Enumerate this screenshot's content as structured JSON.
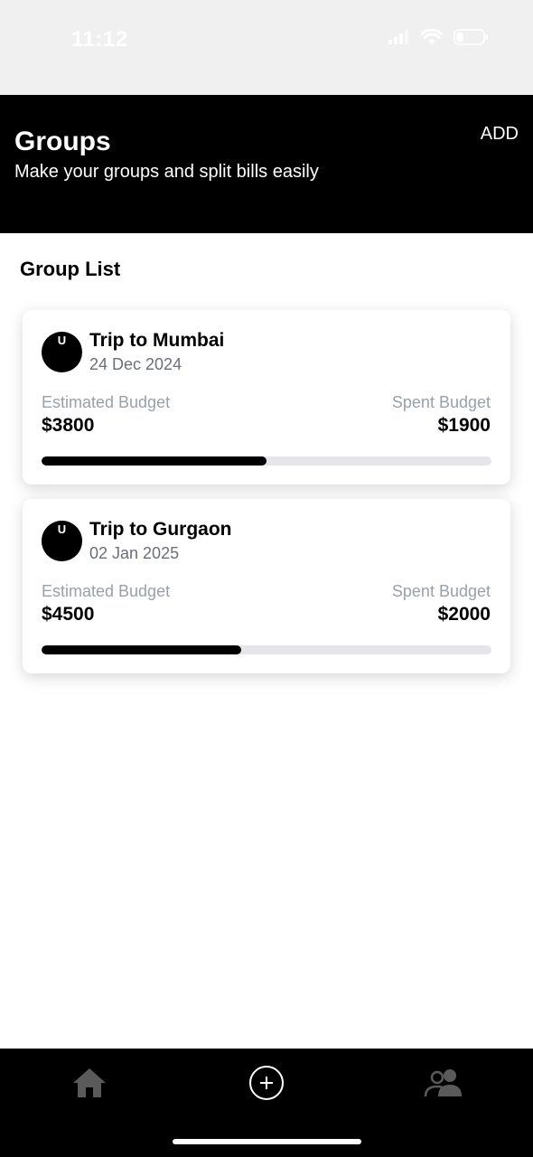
{
  "status_bar": {
    "time": "11:12"
  },
  "header": {
    "title": "Groups",
    "subtitle": "Make your groups and split bills easily",
    "add_label": "ADD"
  },
  "group_list": {
    "title": "Group List",
    "groups": [
      {
        "avatar_initial": "U",
        "name": "Trip to Mumbai",
        "date": "24 Dec 2024",
        "estimated_label": "Estimated Budget",
        "estimated_value": "$3800",
        "spent_label": "Spent Budget",
        "spent_value": "$1900",
        "progress": 0.5
      },
      {
        "avatar_initial": "U",
        "name": "Trip to Gurgaon",
        "date": "02 Jan 2025",
        "estimated_label": "Estimated Budget",
        "estimated_value": "$4500",
        "spent_label": "Spent Budget",
        "spent_value": "$2000",
        "progress": 0.444
      }
    ]
  },
  "bottom_nav": {
    "items": [
      {
        "icon": "home-icon"
      },
      {
        "icon": "add-circle-icon"
      },
      {
        "icon": "users-icon"
      }
    ]
  },
  "colors": {
    "header_bg": "#000000",
    "progress_fill": "#000000",
    "progress_track": "#e6e6ea",
    "muted_text": "#9aa0a8"
  }
}
